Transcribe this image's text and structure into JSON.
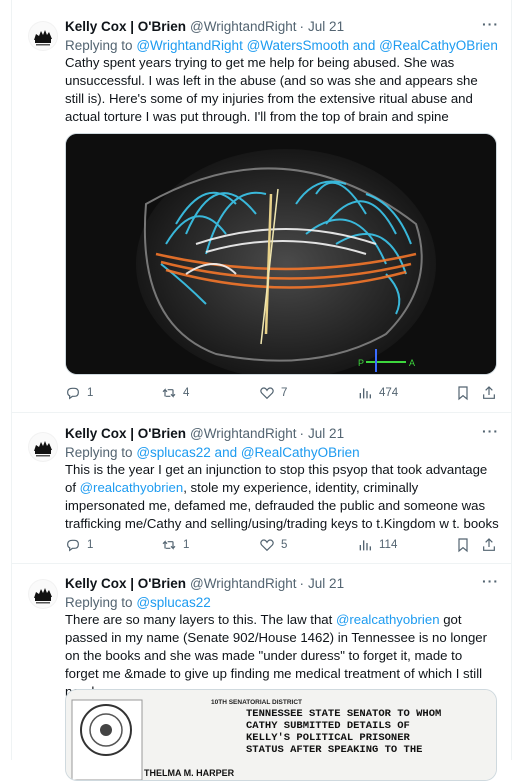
{
  "tweets": [
    {
      "name": "Kelly Cox | O'Brien",
      "handle": "@WrightandRight",
      "dot": "·",
      "date": "Jul 21",
      "reply_prefix": "Replying to",
      "reply_to": "@WrightandRight @WatersSmooth and @RealCathyOBrien",
      "text": "Cathy spent years trying to get me help for being abused. She was unsuccessful. I was left in the abuse (and so was she and appears she still is). Here's some of my injuries from the extensive ritual abuse and actual torture I was put through. I'll from the top of brain and spine",
      "media_icon": "brain-mri-tractography-image",
      "mri_labels": {
        "left": "P",
        "right": "A"
      },
      "actions": {
        "replies": "1",
        "retweets": "4",
        "likes": "7",
        "views": "474"
      }
    },
    {
      "name": "Kelly Cox | O'Brien",
      "handle": "@WrightandRight",
      "dot": "·",
      "date": "Jul 21",
      "reply_prefix": "Replying to",
      "reply_to": "@splucas22 and @RealCathyOBrien",
      "text_before": "This is the year I get an injunction to stop this psyop that took advantage of ",
      "mention": "@realcathyobrien",
      "text_after": ", stole my experience, identity, criminally impersonated me, defamed me, defrauded the public and someone was trafficking me/Cathy and selling/using/trading keys to t.Kingdom w t. books",
      "actions": {
        "replies": "1",
        "retweets": "1",
        "likes": "5",
        "views": "114"
      }
    },
    {
      "name": "Kelly Cox | O'Brien",
      "handle": "@WrightandRight",
      "dot": "·",
      "date": "Jul 21",
      "reply_prefix": "Replying to",
      "reply_to": "@splucas22",
      "text_before": "There are so many layers to this. The law that ",
      "mention": "@realcathyobrien",
      "text_after": " got passed in my name (Senate 902/House 1462) in Tennessee is no longer on the books and she was made \"under duress\" to forget it, made to forget me &made to give up finding me medical treatment of which I still need",
      "media_icon": "scanned-document-image",
      "doc": {
        "district": "10TH SENATORIAL DISTRICT",
        "senator": "THELMA M. HARPER",
        "caption": "TENNESSEE STATE SENATOR TO WHOM CATHY SUBMITTED DETAILS OF KELLY'S POLITICAL PRISONER STATUS AFTER SPEAKING TO THE"
      }
    }
  ],
  "colors": {
    "link": "#1d9bf0",
    "muted": "#536471",
    "text": "#0f1419",
    "border": "#eff3f4"
  }
}
